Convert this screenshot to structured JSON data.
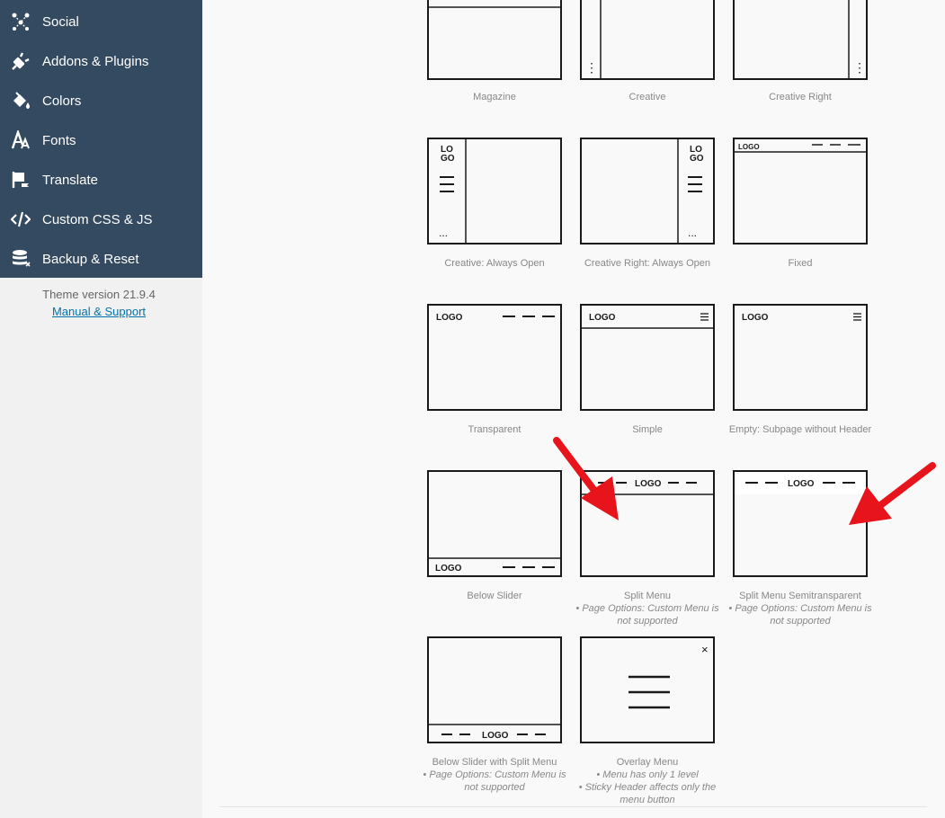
{
  "sidebar": {
    "items": [
      {
        "label": "Social",
        "icon": "social-icon"
      },
      {
        "label": "Addons & Plugins",
        "icon": "plug-icon"
      },
      {
        "label": "Colors",
        "icon": "paint-bucket-icon"
      },
      {
        "label": "Fonts",
        "icon": "font-icon"
      },
      {
        "label": "Translate",
        "icon": "flag-icon"
      },
      {
        "label": "Custom CSS & JS",
        "icon": "code-icon"
      },
      {
        "label": "Backup & Reset",
        "icon": "database-icon"
      }
    ],
    "theme_version": "Theme version 21.9.4",
    "manual_link": "Manual & Support"
  },
  "layouts": [
    {
      "label": "Magazine",
      "notes": []
    },
    {
      "label": "Creative",
      "notes": []
    },
    {
      "label": "Creative Right",
      "notes": []
    },
    {
      "label": "Creative: Always Open",
      "notes": []
    },
    {
      "label": "Creative Right: Always Open",
      "notes": []
    },
    {
      "label": "Fixed",
      "notes": []
    },
    {
      "label": "Transparent",
      "notes": []
    },
    {
      "label": "Simple",
      "notes": []
    },
    {
      "label": "Empty: Subpage without Header",
      "notes": []
    },
    {
      "label": "Below Slider",
      "notes": []
    },
    {
      "label": "Split Menu",
      "notes": [
        "• Page Options: Custom Menu is not supported"
      ]
    },
    {
      "label": "Split Menu Semitransparent",
      "notes": [
        "• Page Options: Custom Menu is not supported"
      ]
    },
    {
      "label": "Below Slider with Split Menu",
      "notes": [
        "• Page Options: Custom Menu is not supported"
      ]
    },
    {
      "label": "Overlay Menu",
      "notes": [
        "• Menu has only 1 level",
        "• Sticky Header affects only the menu button"
      ]
    }
  ],
  "tile_text": {
    "logo": "LOGO",
    "logo_top": "LO",
    "logo_bottom": "GO",
    "close": "×",
    "dots": "⋮",
    "dots_horizontal": "..."
  },
  "colors": {
    "sidebar_bg": "#334a60",
    "arrow": "#e8141b",
    "link": "#0073aa"
  }
}
